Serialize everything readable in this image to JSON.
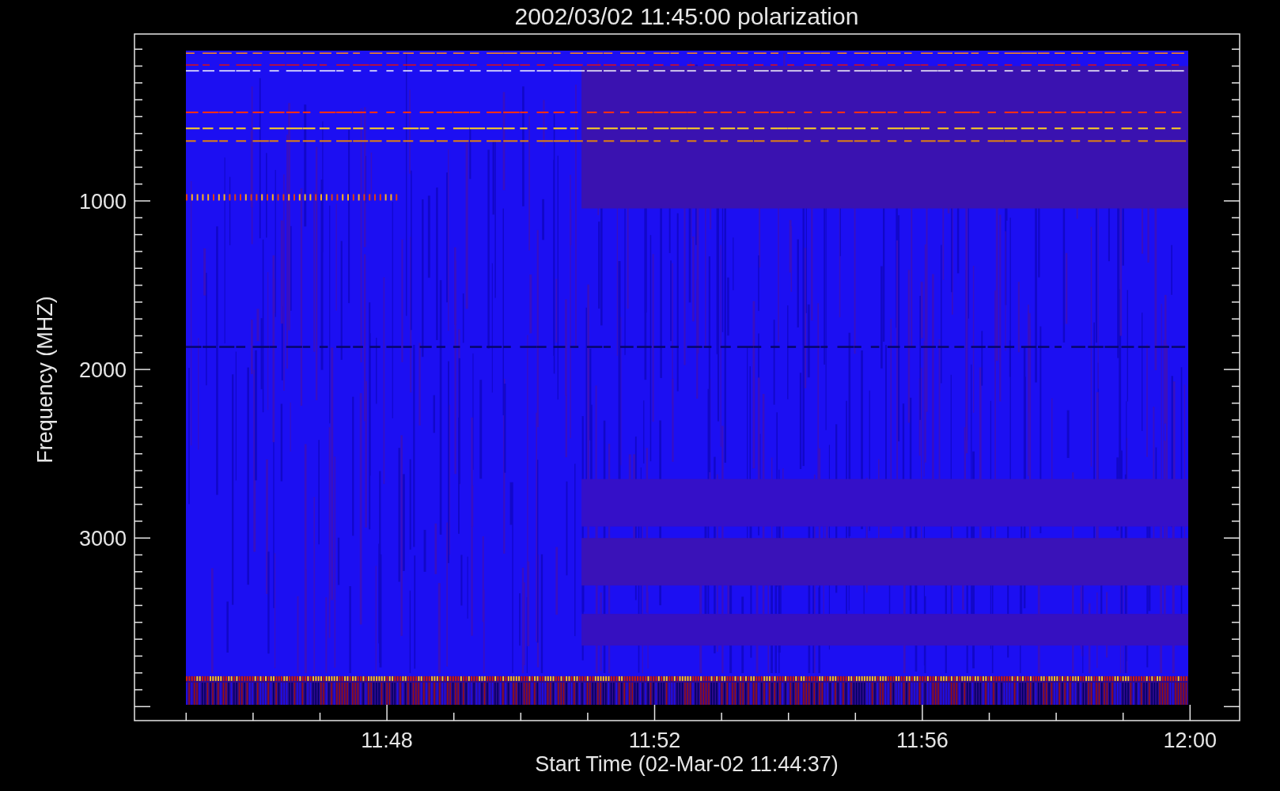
{
  "plot": {
    "title": "2002/03/02 11:45:00 polarization",
    "ylabel": "Frequency (MHZ)",
    "xlabel": "Start Time (02-Mar-02 11:44:37)",
    "yticks": [
      "1000",
      "2000",
      "3000"
    ],
    "xticks": [
      "11:48",
      "11:52",
      "11:56",
      "12:00"
    ]
  }
}
